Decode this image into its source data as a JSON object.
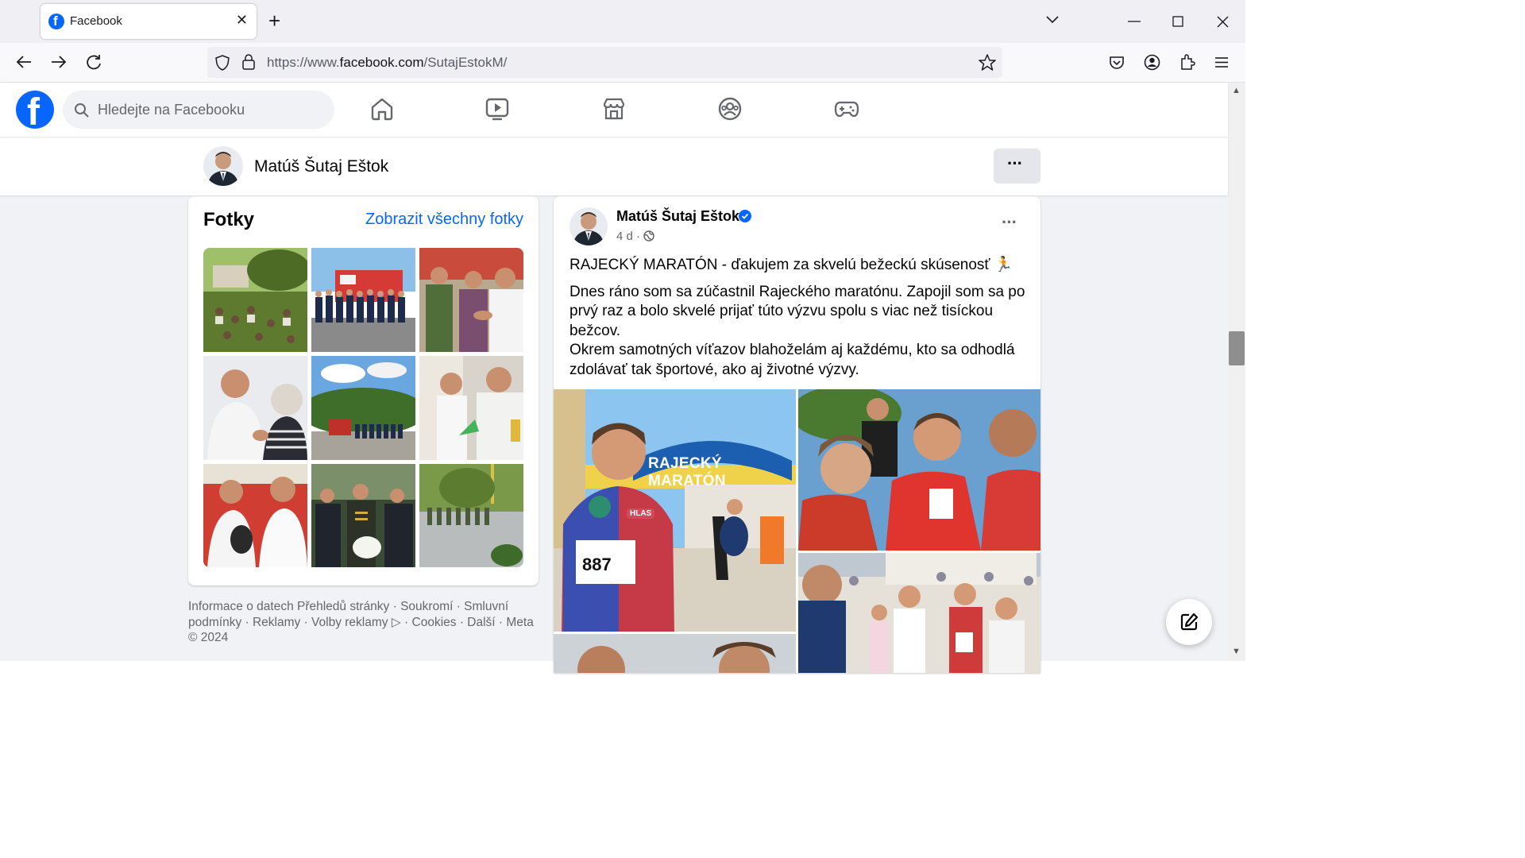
{
  "browser": {
    "tab_title": "Facebook",
    "url_prefix": "https://www.",
    "url_domain": "facebook.com",
    "url_path": "/SutajEstokM/"
  },
  "fb": {
    "search_placeholder": "Hledejte na Facebooku",
    "nav_icons": [
      "home-icon",
      "video-icon",
      "marketplace-icon",
      "groups-icon",
      "gaming-icon"
    ]
  },
  "profile": {
    "name": "Matúš Šutaj Eštok",
    "more_label": "···"
  },
  "photos": {
    "title": "Fotky",
    "link": "Zobrazit všechny fotky",
    "count": 9
  },
  "footer": {
    "text": "Informace o datech Přehledů stránky · Soukromí · Smluvní podmínky · Reklamy · Volby reklamy ▷ · Cookies · Další · Meta © 2024"
  },
  "post": {
    "author": "Matúš Šutaj Eštok",
    "time": "4 d",
    "more_label": "···",
    "title_line": "RAJECKÝ MARATÓN - ďakujem za skvelú bežeckú skúsenosť 🏃",
    "paragraph1": "Dnes ráno som sa zúčastnil Rajeckého maratónu. Zapojil som sa po prvý raz a bolo skvelé prijať túto výzvu spolu s viac než tisíckou bežcov.",
    "paragraph2": "Okrem samotných víťazov blahoželám aj každému, kto sa odhodlá zdolávať tak športové, ako aj životné výzvy.",
    "banner_text": "RAJECKÝ MARATÓN",
    "bib_number": "887",
    "shirt_brand": "HLAS"
  },
  "colors": {
    "fb_blue": "#0866ff",
    "page_bg": "#f0f2f5"
  }
}
